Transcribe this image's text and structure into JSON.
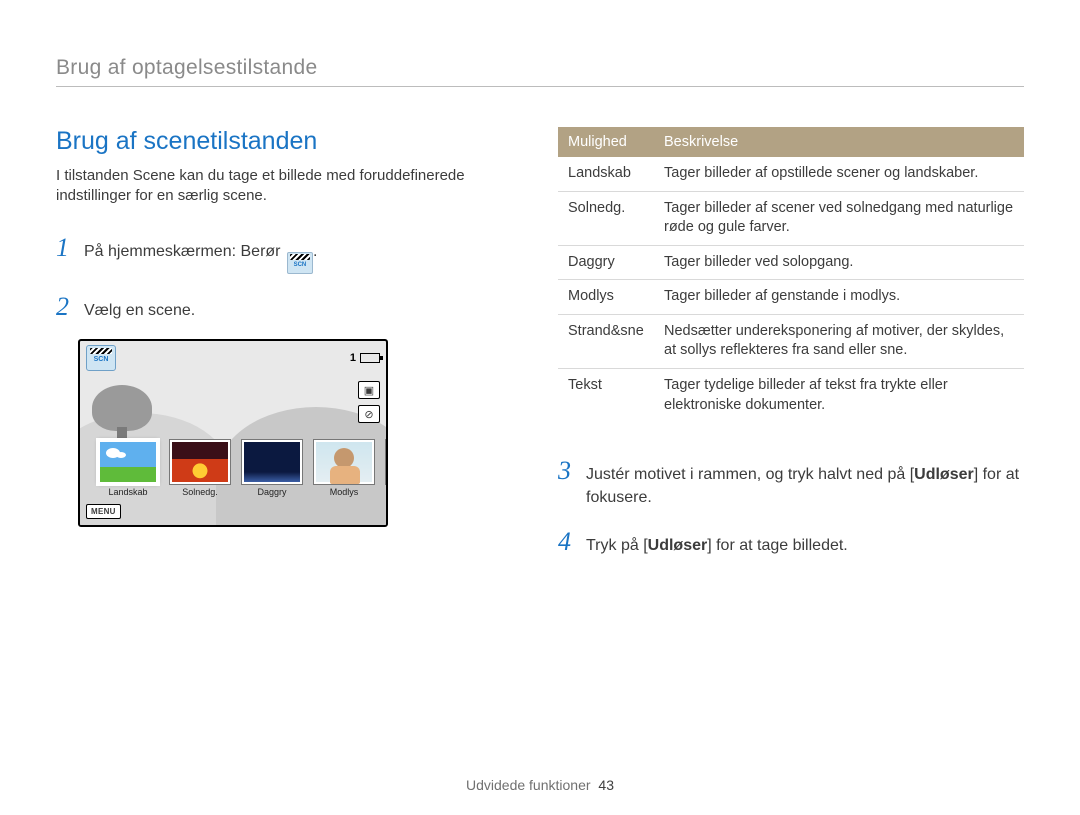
{
  "header": {
    "breadcrumb": "Brug af optagelsestilstande"
  },
  "section": {
    "title": "Brug af scenetilstanden",
    "intro": "I tilstanden Scene kan du tage et billede med foruddefinerede indstillinger for en særlig scene."
  },
  "steps": {
    "s1_prefix": "På hjemmeskærmen: Berør ",
    "s1_suffix": ".",
    "s2": "Vælg en scene.",
    "s3_a": "Justér motivet i rammen, og tryk halvt ned på [",
    "s3_b": "Udløser",
    "s3_c": "] for at fokusere.",
    "s4_a": "Tryk på [",
    "s4_b": "Udløser",
    "s4_c": "] for at tage billedet."
  },
  "step_numbers": {
    "n1": "1",
    "n2": "2",
    "n3": "3",
    "n4": "4"
  },
  "scn_icon": {
    "label": "SCN"
  },
  "lcd": {
    "scn_label": "SCN",
    "counter": "1",
    "menu": "MENU",
    "icon_capture": "▣",
    "icon_flash": "⊘",
    "thumbs": [
      {
        "label": "Landskab",
        "cls": "t-landskab",
        "selected": true
      },
      {
        "label": "Solnedg.",
        "cls": "t-solnedg",
        "selected": false
      },
      {
        "label": "Daggry",
        "cls": "t-daggry",
        "selected": false
      },
      {
        "label": "Modlys",
        "cls": "t-modlys",
        "selected": false
      }
    ]
  },
  "table": {
    "head": {
      "c1": "Mulighed",
      "c2": "Beskrivelse"
    },
    "rows": [
      {
        "opt": "Landskab",
        "desc": "Tager billeder af opstillede scener og landskaber."
      },
      {
        "opt": "Solnedg.",
        "desc": "Tager billeder af scener ved solnedgang med naturlige røde og gule farver."
      },
      {
        "opt": "Daggry",
        "desc": "Tager billeder ved solopgang."
      },
      {
        "opt": "Modlys",
        "desc": "Tager billeder af genstande i modlys."
      },
      {
        "opt": "Strand&sne",
        "desc": "Nedsætter undereksponering af motiver, der skyldes, at sollys reflekteres fra sand eller sne."
      },
      {
        "opt": "Tekst",
        "desc": "Tager tydelige billeder af tekst fra trykte eller elektroniske dokumenter."
      }
    ]
  },
  "footer": {
    "label": "Udvidede funktioner",
    "page": "43"
  }
}
